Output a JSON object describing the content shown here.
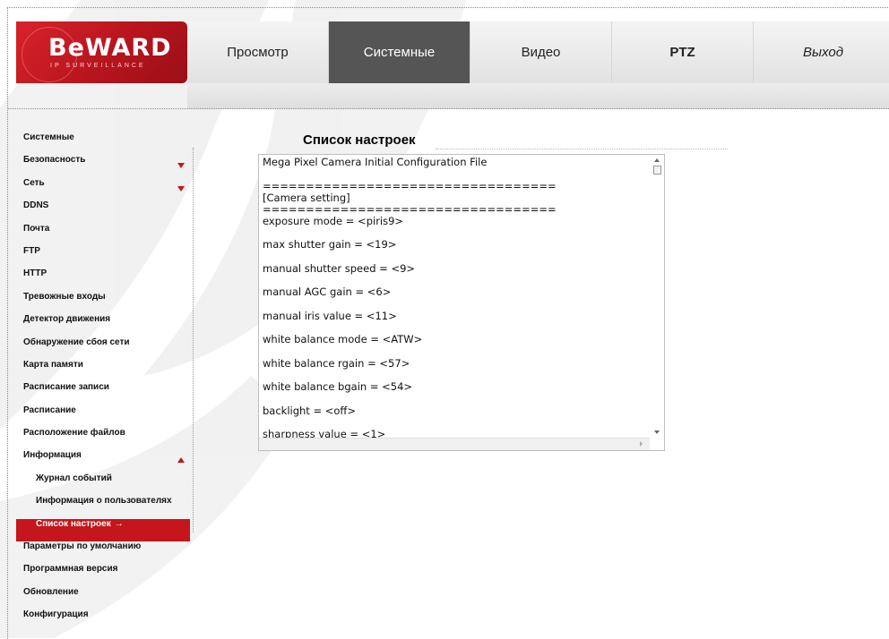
{
  "brand": {
    "logo_text": "BeWARD",
    "logo_subtext": "IP SURVEILLANCE",
    "accent_color": "#c4161c"
  },
  "nav": {
    "items": [
      {
        "label": "Просмотр",
        "active": false
      },
      {
        "label": "Системные",
        "active": true
      },
      {
        "label": "Видео",
        "active": false
      },
      {
        "label": "PTZ",
        "active": false
      },
      {
        "label": "Выход",
        "active": false
      }
    ]
  },
  "sidebar": {
    "items": [
      {
        "label": "Системные"
      },
      {
        "label": "Безопасность",
        "arrow": "down"
      },
      {
        "label": "Сеть",
        "arrow": "down"
      },
      {
        "label": "DDNS"
      },
      {
        "label": "Почта"
      },
      {
        "label": "FTP"
      },
      {
        "label": "HTTP"
      },
      {
        "label": "Тревожные входы"
      },
      {
        "label": "Детектор движения"
      },
      {
        "label": "Обнаружение сбоя сети"
      },
      {
        "label": "Карта памяти"
      },
      {
        "label": "Расписание записи"
      },
      {
        "label": "Расписание"
      },
      {
        "label": "Расположение файлов"
      },
      {
        "label": "Информация",
        "arrow": "up"
      },
      {
        "label": "Журнал событий",
        "sub": true
      },
      {
        "label": "Информация о пользователях",
        "sub": true
      },
      {
        "label": "Список настроек",
        "sub": true,
        "active": true,
        "suffix": "→"
      },
      {
        "label": "Параметры по умолчанию"
      },
      {
        "label": "Программная версия"
      },
      {
        "label": "Обновление"
      },
      {
        "label": "Конфигурация"
      }
    ]
  },
  "main": {
    "title": "Список настроек",
    "config_lines": [
      "Mega Pixel Camera Initial Configuration File",
      "",
      "==================================",
      "[Camera setting]",
      "==================================",
      "exposure mode = <piris9>",
      "",
      "max shutter gain = <19>",
      "",
      "manual shutter speed = <9>",
      "",
      "manual AGC gain = <6>",
      "",
      "manual iris value = <11>",
      "",
      "white balance mode = <ATW>",
      "",
      "white balance rgain = <57>",
      "",
      "white balance bgain = <54>",
      "",
      "backlight = <off>",
      "",
      "sharpness value = <1>"
    ]
  }
}
